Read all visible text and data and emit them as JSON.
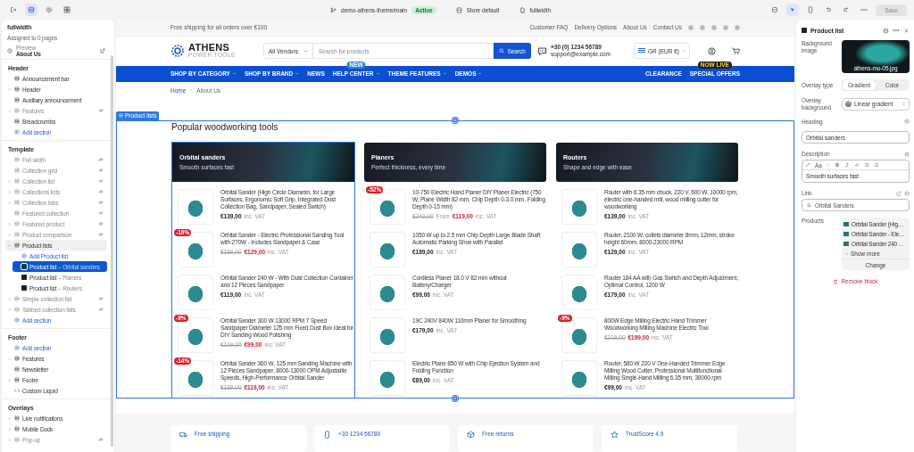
{
  "topbar": {
    "theme": "demo-athens-theme/main",
    "status": "Active",
    "preset": "Store default",
    "template": "fullwidth",
    "save": {
      "label": "Save",
      "disabled": true
    }
  },
  "sidebar": {
    "title": "fullwidth",
    "subtitle": "Assigned to 0 pages",
    "preview": {
      "label": "Preview",
      "value": "About Us"
    },
    "groups": [
      {
        "title": "Header",
        "items": [
          {
            "kind": "section",
            "label": "Announcement bar",
            "expandable": false,
            "expanded": false,
            "hidden": false,
            "selected": false
          },
          {
            "kind": "section",
            "label": "Header",
            "expandable": true,
            "expanded": false,
            "hidden": false,
            "selected": false
          },
          {
            "kind": "section",
            "label": "Auxiliary announcement",
            "expandable": false,
            "expanded": false,
            "hidden": false,
            "selected": false
          },
          {
            "kind": "section",
            "label": "Features",
            "expandable": true,
            "expanded": false,
            "hidden": true,
            "selected": false
          },
          {
            "kind": "section",
            "label": "Breadcrumbs",
            "expandable": false,
            "expanded": false,
            "hidden": false,
            "selected": false
          },
          {
            "kind": "add",
            "label": "Add section",
            "expandable": false,
            "expanded": false,
            "hidden": false,
            "selected": false
          }
        ]
      },
      {
        "title": "Template",
        "items": [
          {
            "kind": "section",
            "label": "Full width",
            "expandable": false,
            "expanded": false,
            "hidden": true,
            "selected": false
          },
          {
            "kind": "section",
            "label": "Collection grid",
            "expandable": false,
            "expanded": false,
            "hidden": true,
            "selected": false
          },
          {
            "kind": "section",
            "label": "Collection list",
            "expandable": true,
            "expanded": false,
            "hidden": true,
            "selected": false
          },
          {
            "kind": "section",
            "label": "Collections lists",
            "expandable": true,
            "expanded": false,
            "hidden": true,
            "selected": false
          },
          {
            "kind": "section",
            "label": "Collection tabs",
            "expandable": true,
            "expanded": false,
            "hidden": true,
            "selected": false
          },
          {
            "kind": "section",
            "label": "Featured collection",
            "expandable": false,
            "expanded": false,
            "hidden": true,
            "selected": false
          },
          {
            "kind": "section",
            "label": "Featured product",
            "expandable": true,
            "expanded": false,
            "hidden": true,
            "selected": false
          },
          {
            "kind": "section",
            "label": "Product comparison",
            "expandable": true,
            "expanded": false,
            "hidden": true,
            "selected": false
          },
          {
            "kind": "section",
            "label": "Product lists",
            "expandable": true,
            "expanded": true,
            "hidden": false,
            "selected": false,
            "children": [
              {
                "kind": "add",
                "label": "Add Product list",
                "expandable": false,
                "expanded": false,
                "hidden": false,
                "selected": false
              },
              {
                "kind": "block",
                "label": "Product list",
                "detail": "– Orbital sanders",
                "expandable": false,
                "expanded": false,
                "hidden": false,
                "selected": true
              },
              {
                "kind": "block",
                "label": "Product list",
                "detail": "– Planers",
                "expandable": false,
                "expanded": false,
                "hidden": false,
                "selected": false
              },
              {
                "kind": "block",
                "label": "Product list",
                "detail": "– Routers",
                "expandable": false,
                "expanded": false,
                "hidden": false,
                "selected": false
              }
            ]
          },
          {
            "kind": "section",
            "label": "Simple collection list",
            "expandable": true,
            "expanded": false,
            "hidden": true,
            "selected": false
          },
          {
            "kind": "section",
            "label": "Tabbed collection lists",
            "expandable": true,
            "expanded": false,
            "hidden": true,
            "selected": false
          },
          {
            "kind": "add",
            "label": "Add section",
            "expandable": false,
            "expanded": false,
            "hidden": false,
            "selected": false
          }
        ]
      },
      {
        "title": "Footer",
        "items": [
          {
            "kind": "add",
            "label": "Add section",
            "expandable": false,
            "expanded": false,
            "hidden": false,
            "selected": false
          },
          {
            "kind": "section",
            "label": "Features",
            "expandable": true,
            "expanded": false,
            "hidden": false,
            "selected": false
          },
          {
            "kind": "section",
            "label": "Newsletter",
            "expandable": false,
            "expanded": false,
            "hidden": false,
            "selected": false
          },
          {
            "kind": "section",
            "label": "Footer",
            "expandable": true,
            "expanded": false,
            "hidden": false,
            "selected": false
          },
          {
            "kind": "code",
            "label": "Custom Liquid",
            "expandable": false,
            "expanded": false,
            "hidden": false,
            "selected": false
          }
        ]
      },
      {
        "title": "Overlays",
        "items": [
          {
            "kind": "section",
            "label": "Live notifications",
            "expandable": true,
            "expanded": false,
            "hidden": false,
            "selected": false
          },
          {
            "kind": "section",
            "label": "Mobile Dock",
            "expandable": true,
            "expanded": false,
            "hidden": false,
            "selected": false
          },
          {
            "kind": "section",
            "label": "Pop-up",
            "expandable": true,
            "expanded": false,
            "hidden": true,
            "selected": false
          }
        ]
      }
    ]
  },
  "store": {
    "announcement": {
      "text": "Free shipping for all orders over €100",
      "links": [
        "Customer FAQ",
        "Delivery Options",
        "About Us",
        "Contact Us"
      ]
    },
    "logo": {
      "name": "ATHENS",
      "tagline": "POWER TOOLS"
    },
    "search": {
      "scope": "All Vendors",
      "placeholder": "Search for products",
      "button": "Search"
    },
    "contact": {
      "phone": "+30 (0) 1234 56789",
      "email": "support@example.com"
    },
    "currency": "GR (EUR €)",
    "nav": {
      "left": [
        {
          "label": "SHOP BY CATEGORY",
          "dropdown": true
        },
        {
          "label": "SHOP BY BRAND",
          "dropdown": true
        },
        {
          "label": "NEWS",
          "dropdown": false
        },
        {
          "label": "HELP CENTER",
          "dropdown": true,
          "badge": "NEW"
        },
        {
          "label": "THEME FEATURES",
          "dropdown": true
        },
        {
          "label": "DEMOS",
          "dropdown": true
        }
      ],
      "right": [
        {
          "label": "CLEARANCE",
          "dropdown": false
        },
        {
          "label": "SPECIAL OFFERS",
          "dropdown": false,
          "badge": "NOW LIVE"
        }
      ]
    },
    "breadcrumb": [
      "Home",
      "About Us"
    ],
    "section_tag": "Product lists",
    "heading": "Popular woodworking tools",
    "columns": [
      {
        "title": "Orbital sanders",
        "subtitle": "Smooth surfaces fast",
        "selected": true,
        "products": [
          {
            "name": "Orbital Sander (High Circle Diameter, for Large Surfaces, Ergonomic Soft Grip, Integrated Dust Collection Bag, Sandpaper, Sealed Switch)",
            "price": "€139,00",
            "vat": "inc. VAT"
          },
          {
            "name": "Orbital Sander - Electric Professional Sanding Tool with 270W - Includes Sandpaper & Case",
            "old_price": "€159,00",
            "price": "€129,00",
            "vat": "inc. VAT",
            "badge": "-19%"
          },
          {
            "name": "Orbital Sander 240 W - With Dust Collection Container and 12 Pieces Sandpaper",
            "price": "€119,00",
            "vat": "inc. VAT"
          },
          {
            "name": "Orbital Sander 300 W 13000 RPM 7 Speed Sandpaper Diameter 125 mm Fixed Dust Box Ideal for DIY Sanding Wood Polishing",
            "old_price": "€109,00",
            "price": "€99,00",
            "vat": "inc. VAT",
            "badge": "-9%"
          },
          {
            "name": "Orbital Sander 360 W, 125 mm Sanding Machine with 12 Pieces Sandpaper, 8000-13000 OPM Adjustable Speeds, High-Performance Orbital Sander",
            "old_price": "€139,00",
            "price": "€119,00",
            "vat": "inc. VAT",
            "badge": "-14%"
          }
        ]
      },
      {
        "title": "Planers",
        "subtitle": "Perfect thickness, every time",
        "selected": false,
        "products": [
          {
            "name": "10-750 Electric Hand Planer DIY Planer Electric (750 W, Plane Width 82 mm, Chip Depth 0-3.0 mm, Folding Depth 0-15 mm)",
            "old_price": "€249,00",
            "prefix": "From",
            "price": "€119,00",
            "vat": "inc. VAT",
            "badge": "-52%"
          },
          {
            "name": "1050 W up to 2.5 mm Chip Depth Large Blade Shaft Automatic Parking Shoe with Parallel",
            "price": "€189,00",
            "vat": "inc. VAT"
          },
          {
            "name": "Cordless Planer 18.0 V 82 mm without Battery/Charger",
            "price": "€99,00",
            "vat": "inc. VAT"
          },
          {
            "name": "19C 240V 840W 110mm Planer for Smoothing",
            "price": "€179,00",
            "vat": "inc. VAT"
          },
          {
            "name": "Electric Plane 850 W with Chip Ejection System and Folding Function",
            "price": "€89,00",
            "vat": "inc. VAT"
          }
        ]
      },
      {
        "title": "Routers",
        "subtitle": "Shape and edge with ease",
        "selected": false,
        "products": [
          {
            "name": "Router with 6.35 mm chuck, 220 V, 600 W, 10000 rpm, electric one-handed mill, wood milling cutter for woodworking",
            "price": "€139,00",
            "vat": "inc. VAT"
          },
          {
            "name": "Router, 2100 W, collets diameter 8mm, 12mm, stroke height 60mm, 8000-23000 RPM",
            "price": "€129,00",
            "vat": "inc. VAT"
          },
          {
            "name": "Router 184 AA with Gas Switch and Depth Adjustment, Optimal Control, 1200 W",
            "price": "€179,00",
            "vat": "inc. VAT"
          },
          {
            "name": "800W Edge Milling Electric Hand Trimmer Woodworking Milling Machine Electric Tool",
            "old_price": "€219,00",
            "price": "€199,00",
            "vat": "inc. VAT",
            "badge": "-9%"
          },
          {
            "name": "Router, 580 W 220 V One-Handed Trimmer Edge Milling Wood Cutter, Professional Multifunctional Milling Single-Hand Milling 6.35 mm, 30000 rpm",
            "price": "€99,00",
            "vat": "inc. VAT"
          }
        ]
      }
    ],
    "features": [
      {
        "kind": "shipping",
        "title": "Free shipping"
      },
      {
        "kind": "phone",
        "title": "+30 1234 56789"
      },
      {
        "kind": "returns",
        "title": "Free returns"
      },
      {
        "kind": "rating",
        "title": "TrustScore 4.9"
      }
    ]
  },
  "panel": {
    "title": "Product list",
    "fields": [
      {
        "kind": "image",
        "label": "Background image",
        "value": "athens-mo-05.jpg"
      },
      {
        "kind": "segmented",
        "label": "Overlay type",
        "options": [
          {
            "label": "Gradient",
            "selected": true
          },
          {
            "label": "Color",
            "selected": false
          }
        ]
      },
      {
        "kind": "select",
        "label": "Overlay background",
        "value": "Linear gradient"
      },
      {
        "kind": "text",
        "label": "Heading",
        "value": "Orbital sanders"
      },
      {
        "kind": "richtext",
        "label": "Description",
        "toolbar": "Aa",
        "value": "Smooth surfaces fast"
      },
      {
        "kind": "link",
        "label": "Link",
        "value": "Orbital Sanders"
      },
      {
        "kind": "products",
        "label": "Products",
        "items": [
          "Orbital Sander (Hig…",
          "Orbital Sander - Ele…",
          "Orbital Sander 240 …"
        ],
        "more": "Show more",
        "action": "Change"
      }
    ],
    "remove": "Remove block"
  }
}
